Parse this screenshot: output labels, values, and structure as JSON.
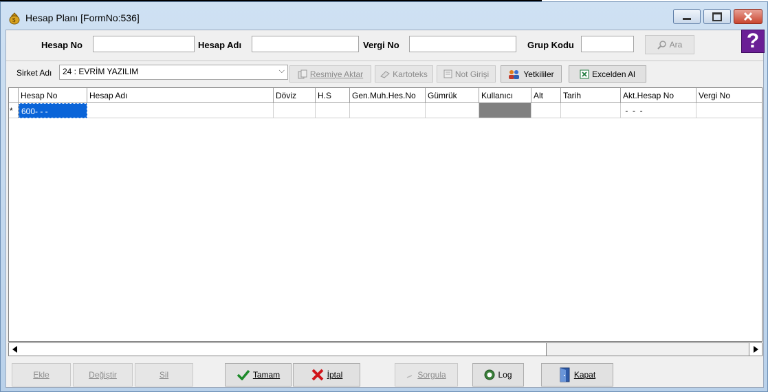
{
  "window": {
    "title": "Hesap Planı [FormNo:536]"
  },
  "search": {
    "hesap_no_label": "Hesap No",
    "hesap_adi_label": "Hesap Adı",
    "vergi_no_label": "Vergi No",
    "grup_kodu_label": "Grup Kodu",
    "ara_button": "Ara",
    "hesap_no_value": "",
    "hesap_adi_value": "",
    "vergi_no_value": "",
    "grup_kodu_value": ""
  },
  "help": {
    "glyph": "?"
  },
  "toolbar": {
    "sirket_label": "Sirket Adı",
    "sirket_value": "24 : EVRİM YAZILIM",
    "resmiye_aktar": "Resmiye Aktar",
    "kartoteks": "Kartoteks",
    "not_girisi": "Not Girişi",
    "yetkililer": "Yetkililer",
    "excelden_al": "Excelden Al"
  },
  "grid": {
    "headers": [
      "Hesap No",
      "Hesap Adı",
      "Döviz",
      "H.S",
      "Gen.Muh.Hes.No",
      "Gümrük",
      "Kullanıcı",
      "Alt",
      "Tarih",
      "Akt.Hesap No",
      "Vergi No"
    ],
    "new_row_marker": "*",
    "row": [
      "600-  -  -",
      "",
      "",
      "",
      "",
      "",
      "",
      "",
      "",
      " -  -  -",
      ""
    ]
  },
  "buttons": {
    "ekle": "Ekle",
    "degistir": "Değiştir",
    "sil": "Sil",
    "tamam": "Tamam",
    "iptal": "İptal",
    "sorgula": "Sorgula",
    "log": "Log",
    "kapat": "Kapat"
  },
  "icons": {
    "app": "money-bag-icon",
    "help": "help-icon",
    "ara": "magnifier-icon",
    "resmiye_aktar": "documents-icon",
    "kartoteks": "cards-icon",
    "not_girisi": "note-icon",
    "yetkililer": "people-icon",
    "excelden_al": "excel-icon",
    "tamam": "check-icon",
    "iptal": "x-icon",
    "sorgula": "query-icon",
    "log": "log-icon",
    "kapat": "door-icon"
  },
  "colors": {
    "selected_cell": "#0a64d8",
    "user_cell": "#808080",
    "help_purple": "#6a1f95",
    "titlebar_close": "#c9452f"
  }
}
